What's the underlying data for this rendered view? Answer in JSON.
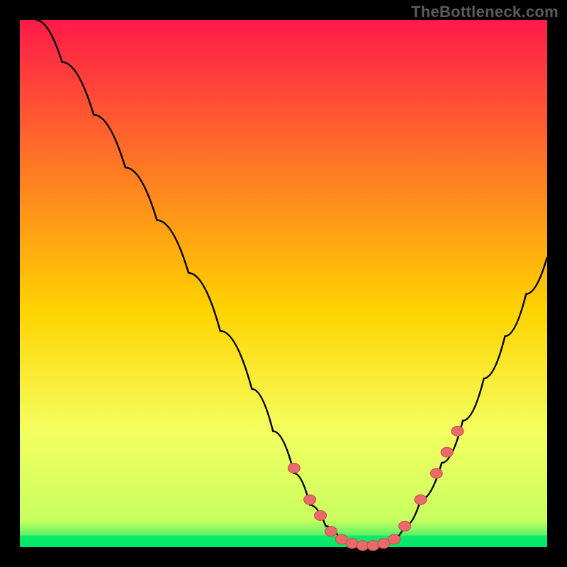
{
  "watermark": {
    "text": "TheBottleneck.com"
  },
  "colors": {
    "background": "#000000",
    "grad_top": "#ff1a4a",
    "grad_mid": "#ffd300",
    "grad_low": "#f4ff60",
    "grad_green": "#00e86b",
    "curve_stroke": "#000000",
    "marker_fill": "#e86a6a",
    "marker_stroke": "#d04848"
  },
  "chart_data": {
    "type": "line",
    "title": "",
    "xlabel": "",
    "ylabel": "",
    "xlim": [
      0,
      100
    ],
    "ylim": [
      0,
      100
    ],
    "series": [
      {
        "name": "bottleneck-curve",
        "x": [
          3,
          8,
          14,
          20,
          26,
          32,
          38,
          44,
          48,
          52,
          55,
          58,
          61,
          64,
          67,
          70,
          73,
          76,
          80,
          84,
          88,
          92,
          96,
          100
        ],
        "y": [
          100,
          92,
          82,
          72,
          62,
          52,
          41,
          30,
          22,
          14,
          8,
          4,
          1,
          0,
          0,
          1,
          4,
          9,
          16,
          24,
          32,
          40,
          48,
          55
        ]
      }
    ],
    "markers": {
      "name": "highlighted-points",
      "x": [
        52,
        55,
        57,
        59,
        61,
        63,
        65,
        67,
        69,
        71,
        73,
        76,
        79,
        81,
        83
      ],
      "y": [
        15,
        9,
        6,
        3,
        1.5,
        0.7,
        0.3,
        0.3,
        0.7,
        1.5,
        4,
        9,
        14,
        18,
        22
      ]
    },
    "gradient_bands_y": [
      0,
      72,
      88,
      93,
      96,
      100
    ]
  }
}
